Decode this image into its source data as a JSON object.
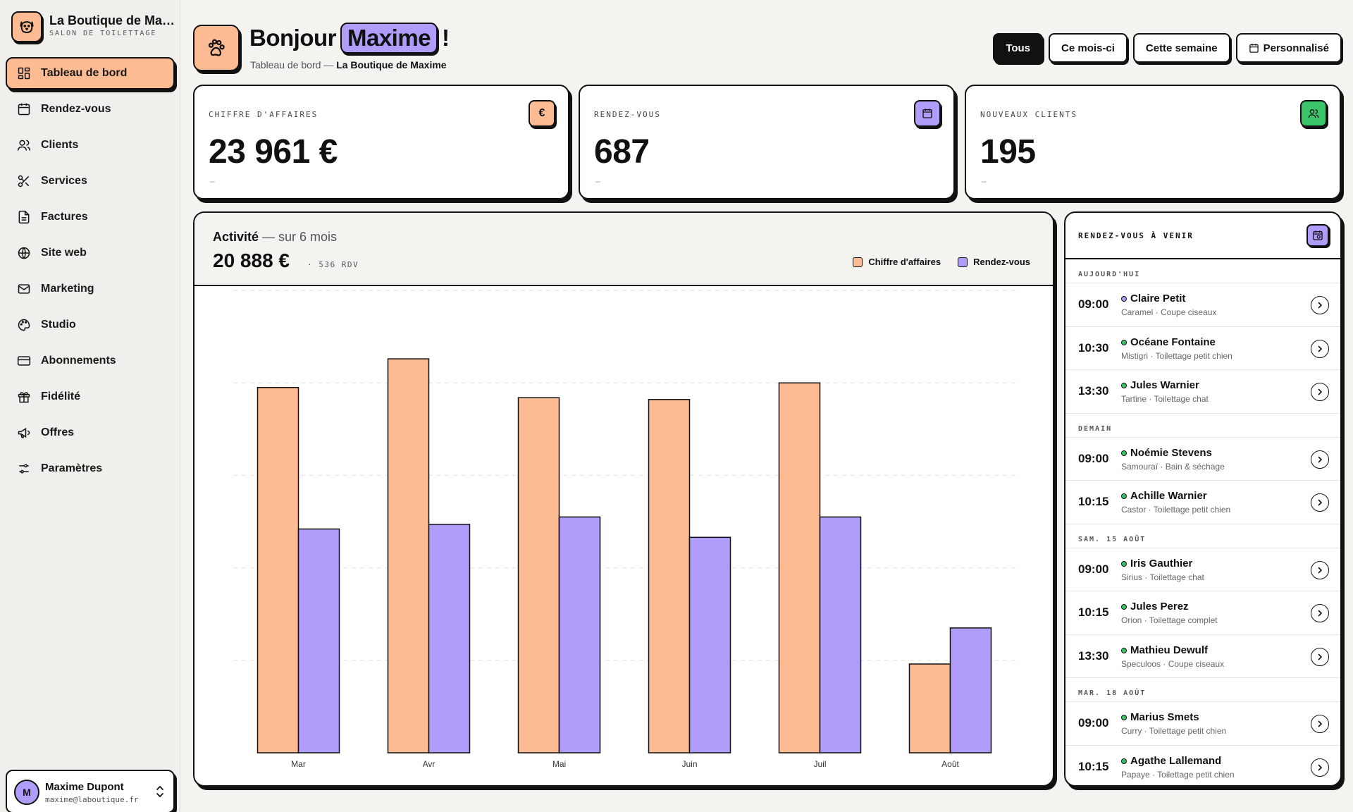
{
  "brand": {
    "name": "La Boutique de Maxime",
    "subtitle": "SALON DE TOILETTAGE"
  },
  "sidebar": {
    "items": [
      {
        "label": "Tableau de bord",
        "icon": "dashboard-icon",
        "active": true
      },
      {
        "label": "Rendez-vous",
        "icon": "calendar-icon"
      },
      {
        "label": "Clients",
        "icon": "users-icon"
      },
      {
        "label": "Services",
        "icon": "scissors-icon"
      },
      {
        "label": "Factures",
        "icon": "invoice-icon"
      },
      {
        "label": "Site web",
        "icon": "globe-icon"
      },
      {
        "label": "Marketing",
        "icon": "mail-icon"
      },
      {
        "label": "Studio",
        "icon": "palette-icon"
      },
      {
        "label": "Abonnements",
        "icon": "credit-card-icon"
      },
      {
        "label": "Fidélité",
        "icon": "gift-icon"
      },
      {
        "label": "Offres",
        "icon": "megaphone-icon"
      },
      {
        "label": "Paramètres",
        "icon": "sliders-icon"
      }
    ]
  },
  "user": {
    "initial": "M",
    "name": "Maxime Dupont",
    "email": "maxime@laboutique.fr"
  },
  "header": {
    "greeting": "Bonjour",
    "name": "Maxime",
    "exclamation": "!",
    "breadcrumb_prefix": "Tableau de bord — ",
    "breadcrumb_current": "La Boutique de Maxime"
  },
  "filters": {
    "all": "Tous",
    "month": "Ce mois-ci",
    "week": "Cette semaine",
    "custom": "Personnalisé"
  },
  "stats": {
    "revenue": {
      "label": "CHIFFRE D'AFFAIRES",
      "value": "23 961 €",
      "delta": "–",
      "icon": "euro-icon",
      "icon_text": "€",
      "color": "#fcbb92"
    },
    "appointments": {
      "label": "RENDEZ-VOUS",
      "value": "687",
      "delta": "–",
      "icon": "calendar-icon",
      "color": "#b09dfa"
    },
    "clients": {
      "label": "NOUVEAUX CLIENTS",
      "value": "195",
      "delta": "–",
      "icon": "users-icon",
      "color": "#3cc46a"
    }
  },
  "activity": {
    "title": "Activité",
    "period": " — sur 6 mois",
    "total": "20 888 €",
    "count": "· 536 RDV"
  },
  "chart_data": {
    "type": "bar",
    "categories": [
      "Mar",
      "Avr",
      "Mai",
      "Juin",
      "Juil",
      "Août"
    ],
    "series": [
      {
        "name": "Chiffre d'affaires",
        "color": "#fcbb92",
        "values": [
          3950,
          4260,
          3840,
          3820,
          4000,
          960
        ]
      },
      {
        "name": "Rendez-vous",
        "color": "#b09dfa",
        "values": [
          2420,
          2470,
          2550,
          2330,
          2550,
          1350
        ]
      }
    ],
    "ylim": [
      0,
      5000
    ],
    "grid": true,
    "legend": "top-right"
  },
  "upcoming": {
    "title": "RENDEZ-VOUS À VENIR",
    "groups": [
      {
        "label": "AUJOURD'HUI",
        "items": [
          {
            "time": "09:00",
            "name": "Claire Petit",
            "detail": "Caramel · Coupe ciseaux",
            "status_color": "#b09dfa"
          },
          {
            "time": "10:30",
            "name": "Océane Fontaine",
            "detail": "Mistigri · Toilettage petit chien",
            "status_color": "#3cc46a"
          },
          {
            "time": "13:30",
            "name": "Jules Warnier",
            "detail": "Tartine · Toilettage chat",
            "status_color": "#3cc46a"
          }
        ]
      },
      {
        "label": "DEMAIN",
        "items": [
          {
            "time": "09:00",
            "name": "Noémie Stevens",
            "detail": "Samouraï · Bain & séchage",
            "status_color": "#3cc46a"
          },
          {
            "time": "10:15",
            "name": "Achille Warnier",
            "detail": "Castor · Toilettage petit chien",
            "status_color": "#3cc46a"
          }
        ]
      },
      {
        "label": "SAM. 15 AOÛT",
        "items": [
          {
            "time": "09:00",
            "name": "Iris Gauthier",
            "detail": "Sirius · Toilettage chat",
            "status_color": "#3cc46a"
          },
          {
            "time": "10:15",
            "name": "Jules Perez",
            "detail": "Orion · Toilettage complet",
            "status_color": "#3cc46a"
          },
          {
            "time": "13:30",
            "name": "Mathieu Dewulf",
            "detail": "Speculoos · Coupe ciseaux",
            "status_color": "#3cc46a"
          }
        ]
      },
      {
        "label": "MAR. 18 AOÛT",
        "items": [
          {
            "time": "09:00",
            "name": "Marius Smets",
            "detail": "Curry · Toilettage petit chien",
            "status_color": "#3cc46a"
          },
          {
            "time": "10:15",
            "name": "Agathe Lallemand",
            "detail": "Papaye · Toilettage petit chien",
            "status_color": "#3cc46a"
          }
        ]
      }
    ]
  }
}
